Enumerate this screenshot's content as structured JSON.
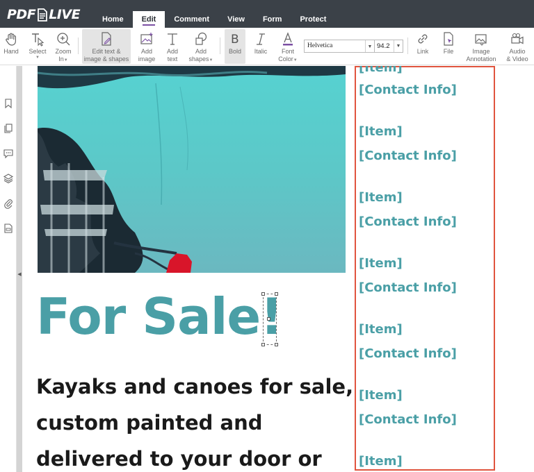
{
  "app": {
    "logo": "PDF",
    "logo_suffix": "LIVE"
  },
  "tabs": [
    {
      "label": "Home"
    },
    {
      "label": "Edit"
    },
    {
      "label": "Comment"
    },
    {
      "label": "View"
    },
    {
      "label": "Form"
    },
    {
      "label": "Protect"
    }
  ],
  "toolbar": {
    "hand": "Hand",
    "select": "Select",
    "zoom_line1": "Zoom",
    "zoom_line2": "In",
    "edit_line1": "Edit text &",
    "edit_line2": "image & shapes",
    "add_image_line1": "Add",
    "add_image_line2": "image",
    "add_text_line1": "Add",
    "add_text_line2": "text",
    "add_shapes_line1": "Add",
    "add_shapes_line2": "shapes",
    "bold": "Bold",
    "italic": "Italic",
    "font_color_line1": "Font",
    "font_color_line2": "Color",
    "font_family": "Helvetica",
    "font_size": "94.2",
    "link": "Link",
    "file": "File",
    "image_annotation_line1": "Image",
    "image_annotation_line2": "Annotation",
    "audio_video_line1": "Audio",
    "audio_video_line2": "& Video"
  },
  "sidebar": {
    "icons": [
      "bookmark-icon",
      "pages-icon",
      "comments-icon",
      "layers-icon",
      "attachment-icon",
      "form-field-icon"
    ]
  },
  "document": {
    "heading": "For Sale",
    "heading_mark": "!",
    "body_lines": [
      "Kayaks and canoes for sale,",
      "custom painted and",
      "delivered to your door or"
    ],
    "list_items": [
      "[Item]",
      "[Contact Info]",
      "[Item]",
      "[Contact Info]",
      "[Item]",
      "[Contact Info]",
      "[Item]",
      "[Contact Info]",
      "[Item]",
      "[Contact Info]",
      "[Item]",
      "[Contact Info]",
      "[Item]"
    ]
  },
  "colors": {
    "topbar": "#3b4148",
    "accent_tab": "#7b4fa3",
    "heading_teal": "#4a9fa6",
    "selection_red": "#e0543e"
  }
}
